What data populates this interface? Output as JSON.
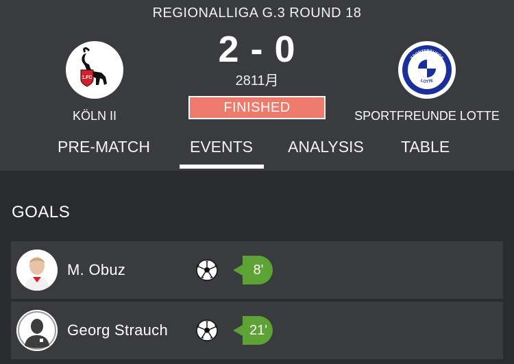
{
  "match": {
    "round_title": "REGIONALLIGA G.3 ROUND 18",
    "score": "2 - 0",
    "date": "2811月",
    "status": "FINISHED",
    "status_color": "#ee7a6c"
  },
  "home_team": {
    "name": "KÖLN II",
    "logo": "fc-koln-crest-icon",
    "logo_text": "1.FC"
  },
  "away_team": {
    "name": "SPORTFREUNDE LOTTE",
    "logo": "sportfreunde-lotte-crest-icon",
    "logo_text_top": "SPORTFREUNDE",
    "logo_text_bottom": "LOTTE"
  },
  "tabs": [
    {
      "label": "PRE-MATCH",
      "active": false
    },
    {
      "label": "EVENTS",
      "active": true
    },
    {
      "label": "ANALYSIS",
      "active": false
    },
    {
      "label": "TABLE",
      "active": false
    }
  ],
  "goals": {
    "title": "GOALS",
    "items": [
      {
        "player": "M. Obuz",
        "minute": "8'",
        "icon": "soccer-ball-icon"
      },
      {
        "player": "Georg Strauch",
        "minute": "21'",
        "icon": "soccer-ball-icon"
      }
    ],
    "minute_color": "#5da234"
  }
}
